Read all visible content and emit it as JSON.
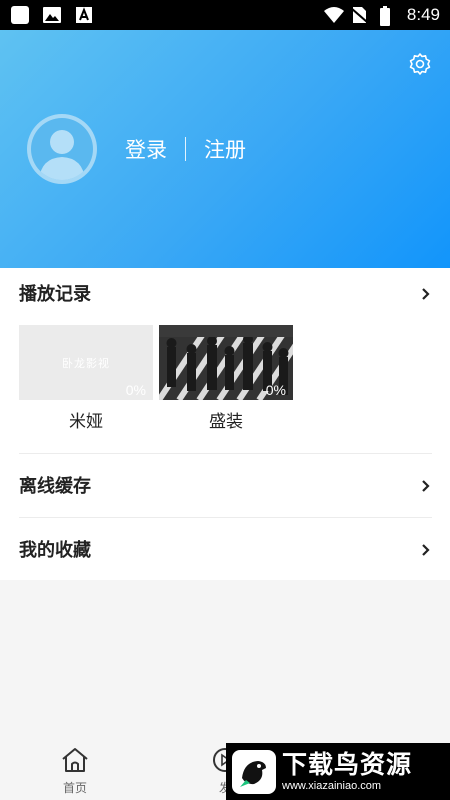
{
  "status_bar": {
    "time": "8:49"
  },
  "header": {
    "login_label": "登录",
    "register_label": "注册"
  },
  "play_history": {
    "title": "播放记录",
    "items": [
      {
        "title": "米娅",
        "placeholder_text": "卧龙影视",
        "progress": "0%"
      },
      {
        "title": "盛装",
        "progress": "0%"
      }
    ]
  },
  "menu": {
    "offline_cache": "离线缓存",
    "favorites": "我的收藏"
  },
  "bottom_nav": {
    "home_label": "首页",
    "discover_label": "发"
  },
  "watermark": {
    "brand": "下载鸟资源",
    "url": "www.xiazainiao.com"
  },
  "colors": {
    "header_gradient_start": "#5fc2f2",
    "header_gradient_end": "#1295fb"
  }
}
